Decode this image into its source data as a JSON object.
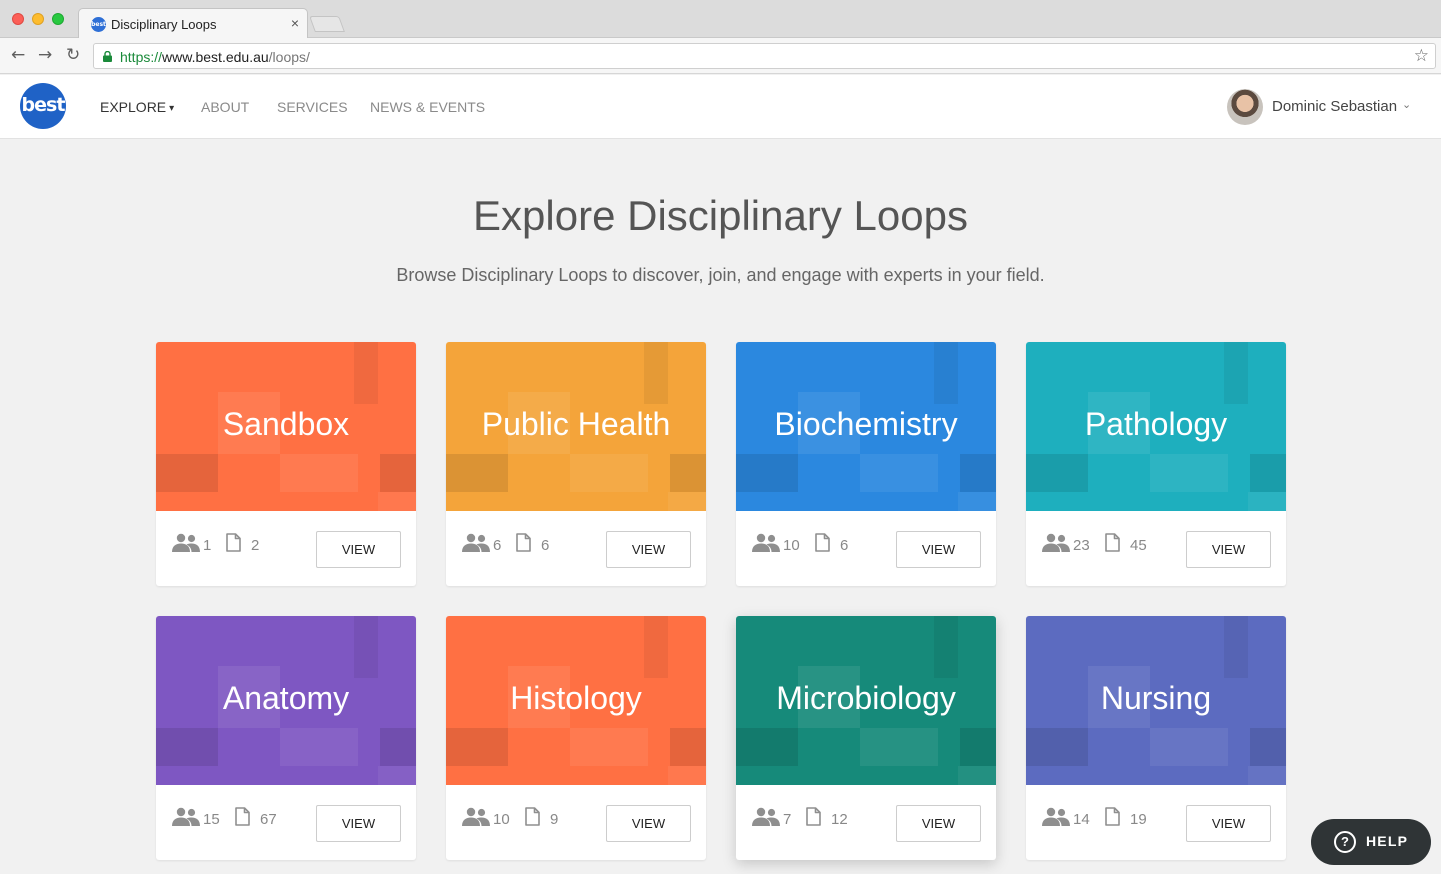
{
  "browser": {
    "tab_title": "Disciplinary Loops",
    "tab_close": "×",
    "favicon_text": "best",
    "url_scheme": "https://",
    "url_host": "www.best.edu.au",
    "url_path": "/loops/",
    "back_glyph": "←",
    "forward_glyph": "→",
    "reload_glyph": "↻",
    "star_glyph": "☆"
  },
  "header": {
    "logo_text": "best",
    "nav": [
      {
        "label": "EXPLORE",
        "has_dropdown": true
      },
      {
        "label": "ABOUT"
      },
      {
        "label": "SERVICES"
      },
      {
        "label": "NEWS & EVENTS"
      }
    ],
    "chevron_glyph": "▾",
    "user_name": "Dominic Sebastian",
    "user_chevron": "⌄"
  },
  "main": {
    "title": "Explore Disciplinary Loops",
    "subtitle": "Browse Disciplinary Loops to discover, join, and engage with experts in your field."
  },
  "loops": [
    {
      "name": "Sandbox",
      "members": "1",
      "resources": "2",
      "color": "#FF7043",
      "view_label": "VIEW"
    },
    {
      "name": "Public Health",
      "members": "6",
      "resources": "6",
      "color": "#F4A43A",
      "view_label": "VIEW"
    },
    {
      "name": "Biochemistry",
      "members": "10",
      "resources": "6",
      "color": "#2B88DF",
      "view_label": "VIEW"
    },
    {
      "name": "Pathology",
      "members": "23",
      "resources": "45",
      "color": "#1EAFBE",
      "view_label": "VIEW"
    },
    {
      "name": "Anatomy",
      "members": "15",
      "resources": "67",
      "color": "#7E57C2",
      "view_label": "VIEW"
    },
    {
      "name": "Histology",
      "members": "10",
      "resources": "9",
      "color": "#FF7043",
      "view_label": "VIEW"
    },
    {
      "name": "Microbiology",
      "members": "7",
      "resources": "12",
      "color": "#168A7A",
      "view_label": "VIEW"
    },
    {
      "name": "Nursing",
      "members": "14",
      "resources": "19",
      "color": "#5C6BC0",
      "view_label": "VIEW"
    }
  ],
  "help": {
    "label": "HELP",
    "icon_glyph": "?"
  }
}
